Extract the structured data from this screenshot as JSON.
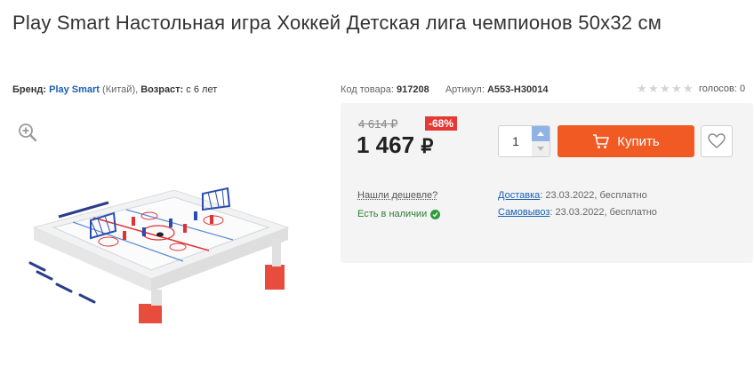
{
  "product": {
    "title": "Play Smart Настольная игра Хоккей Детская лига чемпионов 50x32 см"
  },
  "meta": {
    "brand_label": "Бренд:",
    "brand_name": "Play Smart",
    "brand_country": "(Китай),",
    "age_label": "Возраст:",
    "age_value": "с 6 лет",
    "code_label": "Код товара:",
    "code_value": "917208",
    "article_label": "Артикул:",
    "article_value": "A553-H30014"
  },
  "rating": {
    "stars_filled": 0,
    "stars_total": 5,
    "votes_text": "голосов: 0"
  },
  "pricing": {
    "old_price": "4 614 ₽",
    "discount": "-68%",
    "price": "1 467",
    "currency": "₽"
  },
  "cart": {
    "quantity": "1",
    "buy_label": "Купить"
  },
  "info": {
    "cheaper_link": "Нашли дешевле?",
    "in_stock": "Есть в наличии",
    "delivery_label": "Доставка",
    "delivery_value": ": 23.03.2022, бесплатно",
    "pickup_label": "Самовывоз",
    "pickup_value": ": 23.03.2022, бесплатно"
  },
  "icons": {
    "zoom": "zoom-in-icon",
    "cart": "cart-icon",
    "favorite": "heart-icon",
    "check": "check-circle-icon",
    "star": "star-icon"
  },
  "colors": {
    "buy_button": "#f15a22",
    "discount_badge": "#e53935",
    "link": "#1a5fb4",
    "in_stock": "#2e7d32"
  }
}
